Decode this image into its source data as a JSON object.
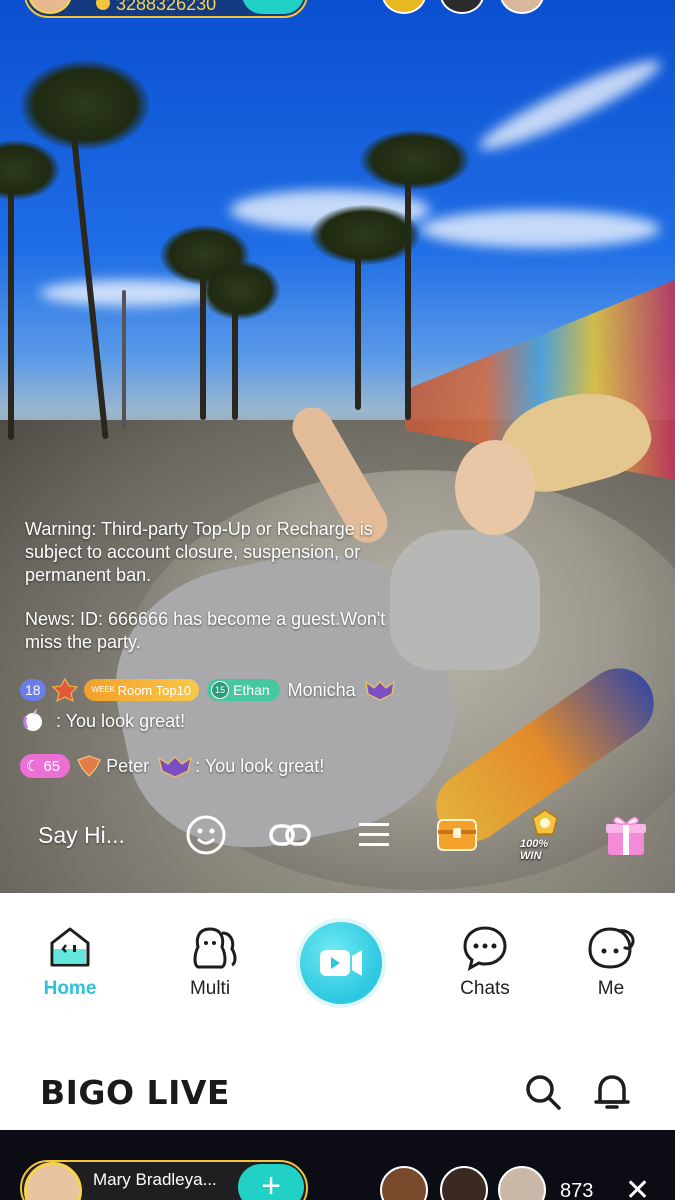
{
  "top_host": {
    "coins": "3288326230"
  },
  "chat": {
    "warning": "Warning: Third-party Top-Up or Recharge is subject to account closure, suspension, or permanent ban.",
    "news": "News: ID: 666666 has become a guest.Won't miss the party.",
    "messages": [
      {
        "level": "18",
        "week_badge_top": "WEEK",
        "week_badge": "Room Top10",
        "fan_level": "15",
        "fan_badge": "Ethan",
        "user": "Monicha",
        "text": ": You look great!"
      },
      {
        "level": "65",
        "user": "Peter",
        "text": ":  You look great!"
      }
    ]
  },
  "live_bar": {
    "say_placeholder": "Say Hi...",
    "promo_label": "100% WIN",
    "icons": [
      "emoji-icon",
      "link-icon",
      "menu-icon",
      "treasure-chest-icon",
      "promo-icon",
      "gift-icon"
    ]
  },
  "nav": {
    "tabs": [
      {
        "label": "Home",
        "icon": "home-icon",
        "active": true
      },
      {
        "label": "Multi",
        "icon": "multi-icon",
        "active": false
      },
      {
        "label": "",
        "icon": "go-live-icon",
        "active": false
      },
      {
        "label": "Chats",
        "icon": "chat-bubble-icon",
        "active": false
      },
      {
        "label": "Me",
        "icon": "profile-icon",
        "active": false
      }
    ],
    "active_color": "#2cc3d6"
  },
  "header": {
    "brand": "BIGO LIVE",
    "icons": [
      "search-icon",
      "bell-icon"
    ]
  },
  "preview": {
    "host_name": "Mary Bradleya...",
    "viewer_count": "873",
    "follow_label": "+",
    "close_label": "✕"
  },
  "colors": {
    "accent": "#21d1c6",
    "gold": "#f6d54a"
  }
}
